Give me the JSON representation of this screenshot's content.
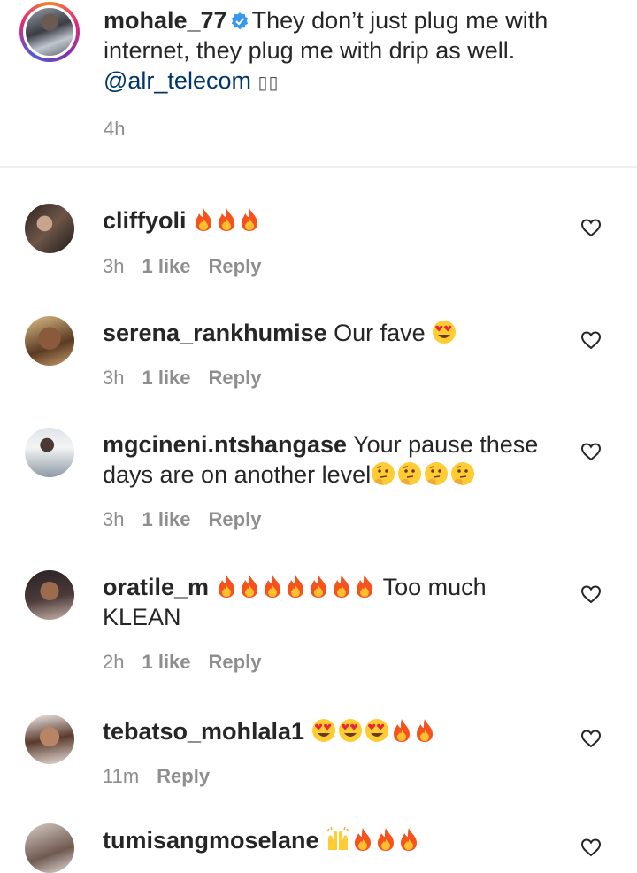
{
  "caption": {
    "username": "mohale_77",
    "text": "They don’t just plug me with internet, they plug me with drip as well.",
    "mention": "@alr_telecom",
    "trailing_glyphs": "▯▯",
    "time": "4h"
  },
  "comments": [
    {
      "username": "cliffyoli",
      "text": "",
      "emoji": [
        "fire",
        "fire",
        "fire"
      ],
      "time": "3h",
      "likes": "1 like",
      "reply": "Reply"
    },
    {
      "username": "serena_rankhumise",
      "text": "Our fave",
      "emoji": [
        "heart-eyes"
      ],
      "time": "3h",
      "likes": "1 like",
      "reply": "Reply"
    },
    {
      "username": "mgcineni.ntshangase",
      "text": "Your pause these days are on another level",
      "emoji": [
        "thinking",
        "thinking",
        "thinking",
        "thinking"
      ],
      "time": "3h",
      "likes": "1 like",
      "reply": "Reply"
    },
    {
      "username": "oratile_m",
      "text_after_emoji": "Too much KLEAN",
      "emoji": [
        "fire",
        "fire",
        "fire",
        "fire",
        "fire",
        "fire",
        "fire"
      ],
      "time": "2h",
      "likes": "1 like",
      "reply": "Reply"
    },
    {
      "username": "tebatso_mohlala1",
      "text": "",
      "emoji": [
        "heart-eyes",
        "heart-eyes",
        "heart-eyes",
        "fire",
        "fire"
      ],
      "time": "11m",
      "likes": "",
      "reply": "Reply"
    },
    {
      "username": "tumisangmoselane",
      "text": "",
      "emoji": [
        "raised-hands",
        "fire",
        "fire",
        "fire"
      ],
      "time": "",
      "likes": "",
      "reply": ""
    }
  ],
  "colors": {
    "mention": "#00376b",
    "meta": "#8e8e8e",
    "verified": "#3897f0",
    "fire": "#f5521d"
  }
}
